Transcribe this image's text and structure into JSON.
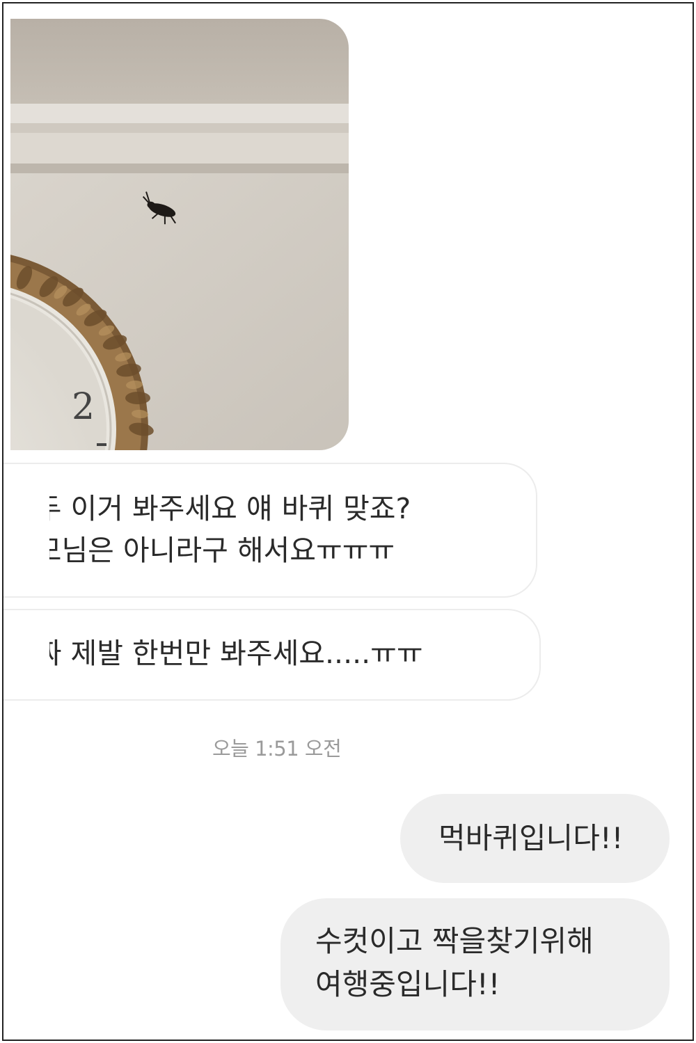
{
  "messages": {
    "photo": {
      "clock_numeral": "2",
      "description_icon": "photo-message"
    },
    "incoming_1": "저두 이거 봐주세요 얘 바퀴 맞죠?\n부모님은 아니라구 해서요ㅠㅠㅠ",
    "incoming_2": "진짜 제발 한번만 봐주세요.....ㅠㅠ",
    "timestamp": "오늘 1:51 오전",
    "outgoing_1": "먹바퀴입니다!!",
    "outgoing_2": "수컷이고 짝을찾기위해\n여행중입니다!!"
  },
  "colors": {
    "background": "#ffffff",
    "incoming_bubble_border": "#ececec",
    "outgoing_bubble": "#efefef",
    "timestamp": "#9a9a9a",
    "text": "#2a2a2a"
  }
}
